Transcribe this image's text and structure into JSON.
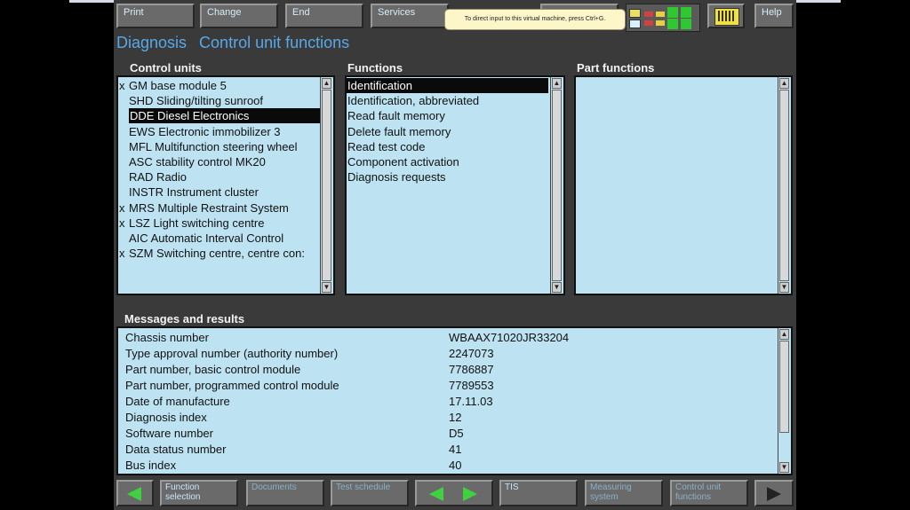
{
  "toolbar": {
    "print_label": "Print",
    "change_label": "Change",
    "end_label": "End",
    "services_label": "Services",
    "help_label": "Help"
  },
  "tooltip": "To direct input to this virtual machine, press Ctrl+G.",
  "heading": {
    "left": "Diagnosis",
    "right": "Control unit functions"
  },
  "control_units": {
    "label": "Control units",
    "items": [
      {
        "mark": "x",
        "text": "GM base module 5"
      },
      {
        "mark": "",
        "text": "SHD Sliding/tilting sunroof"
      },
      {
        "mark": "",
        "text": "DDE Diesel Electronics"
      },
      {
        "mark": "",
        "text": "EWS Electronic immobilizer 3"
      },
      {
        "mark": "",
        "text": "MFL Multifunction steering wheel"
      },
      {
        "mark": "",
        "text": "ASC stability control MK20"
      },
      {
        "mark": "",
        "text": "RAD Radio"
      },
      {
        "mark": "",
        "text": "INSTR Instrument cluster"
      },
      {
        "mark": "x",
        "text": "MRS Multiple Restraint System"
      },
      {
        "mark": "x",
        "text": "LSZ Light switching centre"
      },
      {
        "mark": "",
        "text": "AIC Automatic Interval Control"
      },
      {
        "mark": "x",
        "text": "SZM Switching centre, centre con:"
      }
    ]
  },
  "functions": {
    "label": "Functions",
    "items": [
      "Identification",
      "Identification, abbreviated",
      "Read fault memory",
      "Delete fault memory",
      "Read test code",
      "Component activation",
      "Diagnosis requests"
    ]
  },
  "part_functions": {
    "label": "Part functions"
  },
  "messages": {
    "label": "Messages and results",
    "rows": [
      {
        "name": "Chassis number",
        "value": "WBAAX71020JR33204"
      },
      {
        "name": "Type approval number (authority number)",
        "value": "2247073"
      },
      {
        "name": "Part number, basic control module",
        "value": "7786887"
      },
      {
        "name": "Part number, programmed control module",
        "value": "7789553"
      },
      {
        "name": "Date of manufacture",
        "value": "17.11.03"
      },
      {
        "name": "Diagnosis index",
        "value": "12"
      },
      {
        "name": "Software number",
        "value": "D5"
      },
      {
        "name": "Data status number",
        "value": "41"
      },
      {
        "name": "Bus index",
        "value": "40"
      }
    ]
  },
  "bottom": {
    "function_selection": "Function selection",
    "documents": "Documents",
    "test_schedule": "Test schedule",
    "tis": "TIS",
    "measuring_system": "Measuring system",
    "control_unit_functions": "Control unit functions"
  },
  "colors": {
    "panel_bg": "#bde3f2",
    "app_bg": "#3a3a3a",
    "heading": "#58a8e8",
    "arrow_green": "#3fd23f"
  },
  "icons": {
    "selected": "Identification",
    "selected_unit": "DDE Diesel Electronics"
  }
}
